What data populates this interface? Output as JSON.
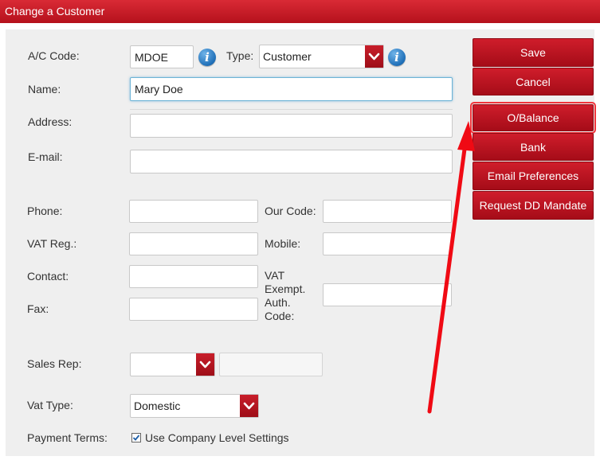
{
  "window": {
    "title": "Change a Customer"
  },
  "form": {
    "ac_code": {
      "label": "A/C Code:",
      "value": "MDOE"
    },
    "type": {
      "label": "Type:",
      "value": "Customer"
    },
    "name": {
      "label": "Name:",
      "value": "Mary Doe"
    },
    "address": {
      "label": "Address:",
      "value": ""
    },
    "email": {
      "label": "E-mail:",
      "value": ""
    },
    "phone": {
      "label": "Phone:",
      "value": ""
    },
    "our_code": {
      "label": "Our Code:",
      "value": ""
    },
    "vat_reg": {
      "label": "VAT Reg.:",
      "value": ""
    },
    "mobile": {
      "label": "Mobile:",
      "value": ""
    },
    "contact": {
      "label": "Contact:",
      "value": ""
    },
    "vat_exempt": {
      "label_lines": [
        "VAT",
        "Exempt.",
        "Auth.",
        "Code:"
      ],
      "value": ""
    },
    "fax": {
      "label": "Fax:",
      "value": ""
    },
    "sales_rep": {
      "label": "Sales Rep:",
      "value": "",
      "name_value": ""
    },
    "vat_type": {
      "label": "Vat Type:",
      "value": "Domestic"
    },
    "payment_terms": {
      "label": "Payment Terms:",
      "checkbox_label": "Use Company Level Settings",
      "checked": true
    }
  },
  "buttons": {
    "save": "Save",
    "cancel": "Cancel",
    "opening_balance": "O/Balance",
    "bank": "Bank",
    "email_prefs": "Email Preferences",
    "dd_mandate": "Request DD Mandate"
  },
  "colors": {
    "brand_red": "#c0141f",
    "annotation_arrow": "#f00a14",
    "info_blue": "#1f6fb8",
    "focus_border": "#6cb3d6"
  },
  "icons": {
    "info": "info-icon",
    "dropdown": "chevron-down-icon",
    "check": "check-icon"
  }
}
